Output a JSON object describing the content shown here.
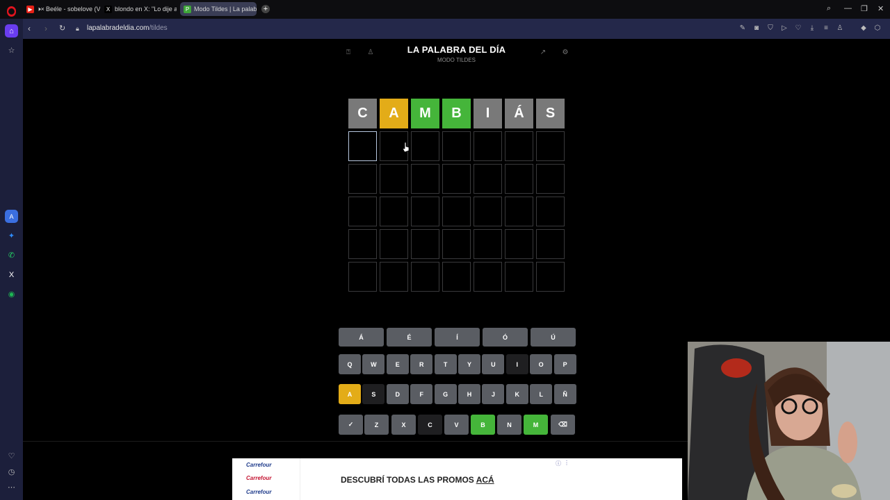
{
  "browser": {
    "tabs": [
      {
        "title": "Beéle - sobelove (Vide",
        "icon": "youtube-icon",
        "muted": "🕨×"
      },
      {
        "title": "blondo en X: \"Lo dije adiv",
        "icon": "x-icon"
      },
      {
        "title": "Modo Tildes | La palabra",
        "icon": "palabra-icon",
        "active": true
      }
    ],
    "favicons": {
      "youtube": "▶",
      "x": "X",
      "palabra": "P"
    },
    "new_tab_label": "+",
    "url_domain": "lapalabradeldia.com",
    "url_path": "/tildes"
  },
  "game": {
    "title": "LA PALABRA DEL DÍA",
    "subtitle": "MODO TILDES",
    "guess_rows": [
      [
        {
          "l": "C",
          "s": "x"
        },
        {
          "l": "A",
          "s": "y"
        },
        {
          "l": "M",
          "s": "g"
        },
        {
          "l": "B",
          "s": "g"
        },
        {
          "l": "I",
          "s": "x"
        },
        {
          "l": "Á",
          "s": "x"
        },
        {
          "l": "S",
          "s": "x"
        }
      ]
    ],
    "rows": 6,
    "cols": 7,
    "active_cell": {
      "row": 1,
      "col": 0
    }
  },
  "keyboard": {
    "tilde_row": [
      {
        "k": "Á",
        "s": "dark"
      },
      {
        "k": "É",
        "s": ""
      },
      {
        "k": "Í",
        "s": ""
      },
      {
        "k": "Ó",
        "s": ""
      },
      {
        "k": "Ú",
        "s": ""
      }
    ],
    "row1": [
      {
        "k": "Q",
        "s": ""
      },
      {
        "k": "W",
        "s": ""
      },
      {
        "k": "E",
        "s": ""
      },
      {
        "k": "R",
        "s": ""
      },
      {
        "k": "T",
        "s": ""
      },
      {
        "k": "Y",
        "s": ""
      },
      {
        "k": "U",
        "s": ""
      },
      {
        "k": "I",
        "s": "dark"
      },
      {
        "k": "O",
        "s": ""
      },
      {
        "k": "P",
        "s": ""
      }
    ],
    "row2": [
      {
        "k": "A",
        "s": "y"
      },
      {
        "k": "S",
        "s": "dark"
      },
      {
        "k": "D",
        "s": ""
      },
      {
        "k": "F",
        "s": ""
      },
      {
        "k": "G",
        "s": ""
      },
      {
        "k": "H",
        "s": ""
      },
      {
        "k": "J",
        "s": ""
      },
      {
        "k": "K",
        "s": ""
      },
      {
        "k": "L",
        "s": ""
      },
      {
        "k": "Ñ",
        "s": ""
      }
    ],
    "row3": [
      {
        "k": "✓",
        "s": ""
      },
      {
        "k": "Z",
        "s": ""
      },
      {
        "k": "X",
        "s": ""
      },
      {
        "k": "C",
        "s": "dark"
      },
      {
        "k": "V",
        "s": ""
      },
      {
        "k": "B",
        "s": "g"
      },
      {
        "k": "N",
        "s": ""
      },
      {
        "k": "M",
        "s": "g"
      },
      {
        "k": "⌫",
        "s": ""
      }
    ]
  },
  "ad": {
    "brand_lines": [
      "Carrefour",
      "Carrefour",
      "Carrefour"
    ],
    "message": "DESCUBRÍ TODAS LAS PROMOS",
    "message_link": "ACÁ"
  },
  "colors": {
    "green": "#45b53a",
    "yellow": "#e3ac18",
    "gray": "#797979",
    "opera_red": "#e0141f"
  }
}
